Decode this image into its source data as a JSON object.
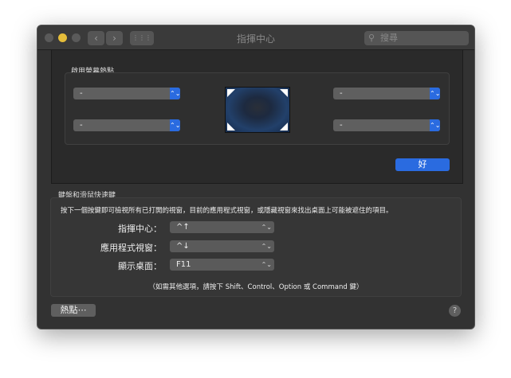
{
  "window": {
    "title": "指揮中心",
    "search_placeholder": "搜尋",
    "back": "‹",
    "forward": "›",
    "grid": "⋮⋮⋮"
  },
  "hot_corners": {
    "title": "啟用螢幕熱點",
    "top_left": "-",
    "top_right": "-",
    "bottom_left": "-",
    "bottom_right": "-",
    "ok_label": "好"
  },
  "shortcuts": {
    "title": "鍵盤和滑鼠快速鍵",
    "description": "按下一個按鍵即可檢視所有已打開的視窗，目前的應用程式視窗，或隱藏視窗來找出桌面上可能被遮住的項目。",
    "rows": [
      {
        "label": "指揮中心：",
        "value": "^↑"
      },
      {
        "label": "應用程式視窗：",
        "value": "^↓"
      },
      {
        "label": "顯示桌面：",
        "value": "F11"
      }
    ],
    "footnote": "（如需其他選項，請按下 Shift、Control、Option 或 Command 鍵）"
  },
  "footer": {
    "hot_corners_button": "熱點⋯",
    "help": "?"
  },
  "colors": {
    "accent": "#2a6be0",
    "background": "#323232"
  }
}
